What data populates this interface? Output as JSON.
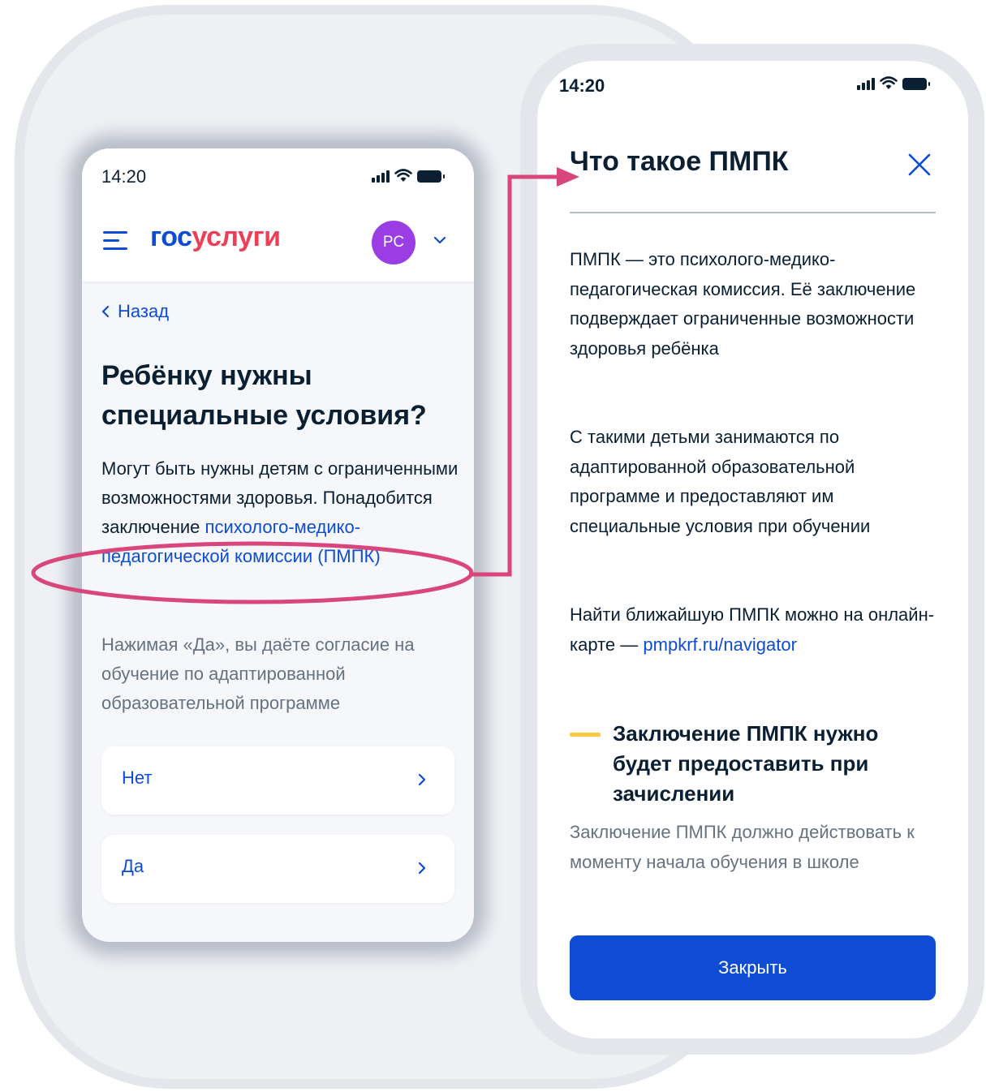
{
  "left_screen": {
    "time": "14:20",
    "logo": {
      "part1": "гос",
      "part2": "услуги"
    },
    "avatar_initials": "РС",
    "back_label": "Назад",
    "title": "Ребёнку нужны специальные условия?",
    "description_text": "Могут быть нужны детям с ограниченными возможностями здоровья. Понадобится заключение",
    "description_link": "психолого-медико-педагогической комиссии (ПМПК)",
    "consent_note": "Нажимая «Да», вы даёте согласие на обучение по адаптированной образовательной программе",
    "options": [
      {
        "label": "Нет"
      },
      {
        "label": "Да"
      }
    ]
  },
  "right_screen": {
    "time": "14:20",
    "title": "Что такое ПМПК",
    "paragraph1": "ПМПК — это психолого-медико-педагогическая комиссия. Её заключение подверждает ограниченные возможности здоровья ребёнка",
    "paragraph2": "С такими детьми занимаются по адаптированной образовательной программе и предоставляют им специальные условия при обучении",
    "paragraph3_text": "Найти ближайшую ПМПК можно на онлайн-карте — ",
    "paragraph3_link": "pmpkrf.ru/navigator",
    "callout_title": "Заключение ПМПК нужно будет предоставить при зачислении",
    "callout_text": "Заключение ПМПК должно действовать к моменту начала обучения в школе",
    "close_button": "Закрыть"
  },
  "colors": {
    "accent_blue": "#0d4cd3",
    "logo_red": "#ee3f58",
    "annotation_pink": "#d9467c",
    "avatar_purple": "#9b3de4",
    "callout_yellow": "#fbc843"
  }
}
